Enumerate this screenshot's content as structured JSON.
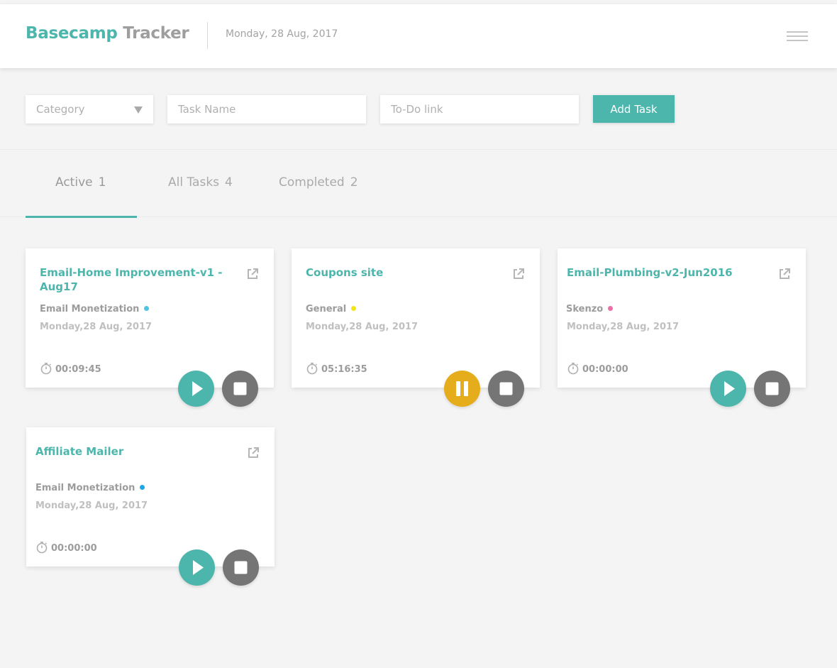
{
  "header": {
    "brand_part1": "Basecamp",
    "brand_part2": "Tracker",
    "date": "Monday, 28 Aug, 2017",
    "menu_icon": "hamburger-icon"
  },
  "form": {
    "category_placeholder": "Category",
    "task_name_placeholder": "Task Name",
    "todo_link_placeholder": "To-Do link",
    "add_button_label": "Add Task"
  },
  "tabs": [
    {
      "label": "Active",
      "count": "1",
      "active": true
    },
    {
      "label": "All Tasks",
      "count": "4",
      "active": false
    },
    {
      "label": "Completed",
      "count": "2",
      "active": false
    }
  ],
  "colors": {
    "accent": "#4db6ac",
    "pause": "#e5ac1c",
    "stop": "#757575"
  },
  "cards": [
    {
      "title": "Email-Home Improvement-v1 -Aug17",
      "category": "Email Monetization",
      "dot_color": "#4fc3e0",
      "date": "Monday,28 Aug, 2017",
      "elapsed": "00:09:45",
      "state": "stopped"
    },
    {
      "title": "Coupons site",
      "category": "General",
      "dot_color": "#f3e41a",
      "date": "Monday,28 Aug, 2017",
      "elapsed": "05:16:35",
      "state": "running"
    },
    {
      "title": "Email-Plumbing-v2-Jun2016",
      "category": "Skenzo",
      "dot_color": "#ec6fa8",
      "date": "Monday,28 Aug, 2017",
      "elapsed": "00:00:00",
      "state": "stopped"
    },
    {
      "title": "Affiliate Mailer",
      "category": "Email Monetization",
      "dot_color": "#1ea6e6",
      "date": "Monday,28 Aug, 2017",
      "elapsed": "00:00:00",
      "state": "stopped"
    }
  ]
}
